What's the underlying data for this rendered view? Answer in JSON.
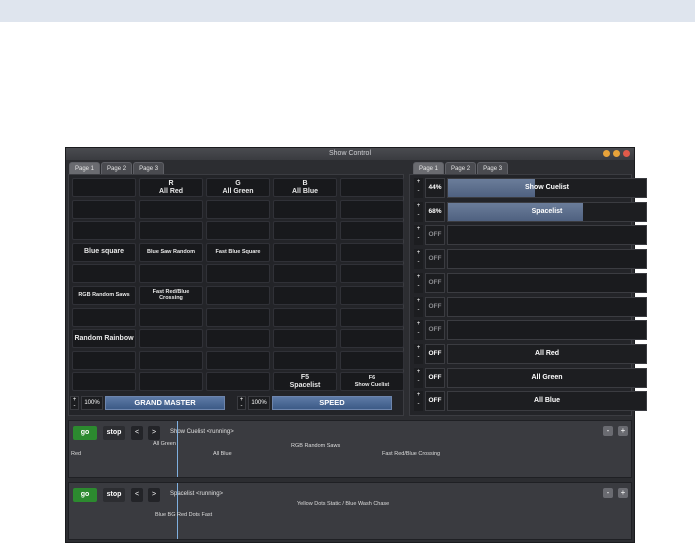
{
  "window": {
    "title": "Show Control"
  },
  "left_tabs": [
    "Page 1",
    "Page 2",
    "Page 3"
  ],
  "right_tabs": [
    "Page 1",
    "Page 2",
    "Page 3"
  ],
  "grid": [
    [
      "",
      "R\nAll Red",
      "G\nAll Green",
      "B\nAll Blue",
      ""
    ],
    [
      "",
      "",
      "",
      "",
      ""
    ],
    [
      "",
      "",
      "",
      "",
      ""
    ],
    [
      "Blue square",
      "Blue Saw Random",
      "Fast Blue Square",
      "",
      ""
    ],
    [
      "",
      "",
      "",
      "",
      ""
    ],
    [
      "RGB Random Saws",
      "Fast Red/Blue\nCrossing",
      "",
      "",
      ""
    ],
    [
      "",
      "",
      "",
      "",
      ""
    ],
    [
      "Random Rainbow",
      "",
      "",
      "",
      ""
    ],
    [
      "",
      "",
      "",
      "",
      ""
    ],
    [
      "",
      "",
      "",
      "F5\nSpacelist",
      "F6\nShow Cuelist"
    ]
  ],
  "master": {
    "plus": "+",
    "minus": "-",
    "percent": "100%",
    "label": "GRAND MASTER",
    "level": 1.0
  },
  "speed": {
    "plus": "+",
    "minus": "-",
    "percent": "100%",
    "label": "SPEED",
    "level": 1.0
  },
  "cuelists": [
    {
      "pct": "44%",
      "label": "Show Cuelist",
      "level": 0.44,
      "off": false
    },
    {
      "pct": "68%",
      "label": "Spacelist",
      "level": 0.68,
      "off": false
    },
    {
      "pct": "OFF",
      "label": "",
      "level": 0,
      "off": true
    },
    {
      "pct": "OFF",
      "label": "",
      "level": 0,
      "off": true
    },
    {
      "pct": "OFF",
      "label": "",
      "level": 0,
      "off": true
    },
    {
      "pct": "OFF",
      "label": "",
      "level": 0,
      "off": true
    },
    {
      "pct": "OFF",
      "label": "",
      "level": 0,
      "off": true
    },
    {
      "pct": "OFF",
      "label": "All Red",
      "level": 0,
      "off": false
    },
    {
      "pct": "OFF",
      "label": "All Green",
      "level": 0,
      "off": false
    },
    {
      "pct": "OFF",
      "label": "All Blue",
      "level": 0,
      "off": false
    }
  ],
  "lanes": [
    {
      "go": "go",
      "stop": "stop",
      "prev": "<",
      "next": ">",
      "status": "Show Cuelist <running>",
      "cues": [
        "Red",
        "All Green",
        "All Blue",
        "RGB Random Saws",
        "Fast Red/Blue Crossing"
      ],
      "minus": "-",
      "plus": "+"
    },
    {
      "go": "go",
      "stop": "stop",
      "prev": "<",
      "next": ">",
      "status": "Spacelist <running>",
      "cues": [
        "Blue BG Red Dots Fast",
        "Yellow Dots Static / Blue Wash Chase"
      ],
      "minus": "-",
      "plus": "+"
    }
  ],
  "colors": {
    "go": "#2c8a2f",
    "fader": "#4f6a96",
    "cuebar": "#5b6d8c"
  }
}
